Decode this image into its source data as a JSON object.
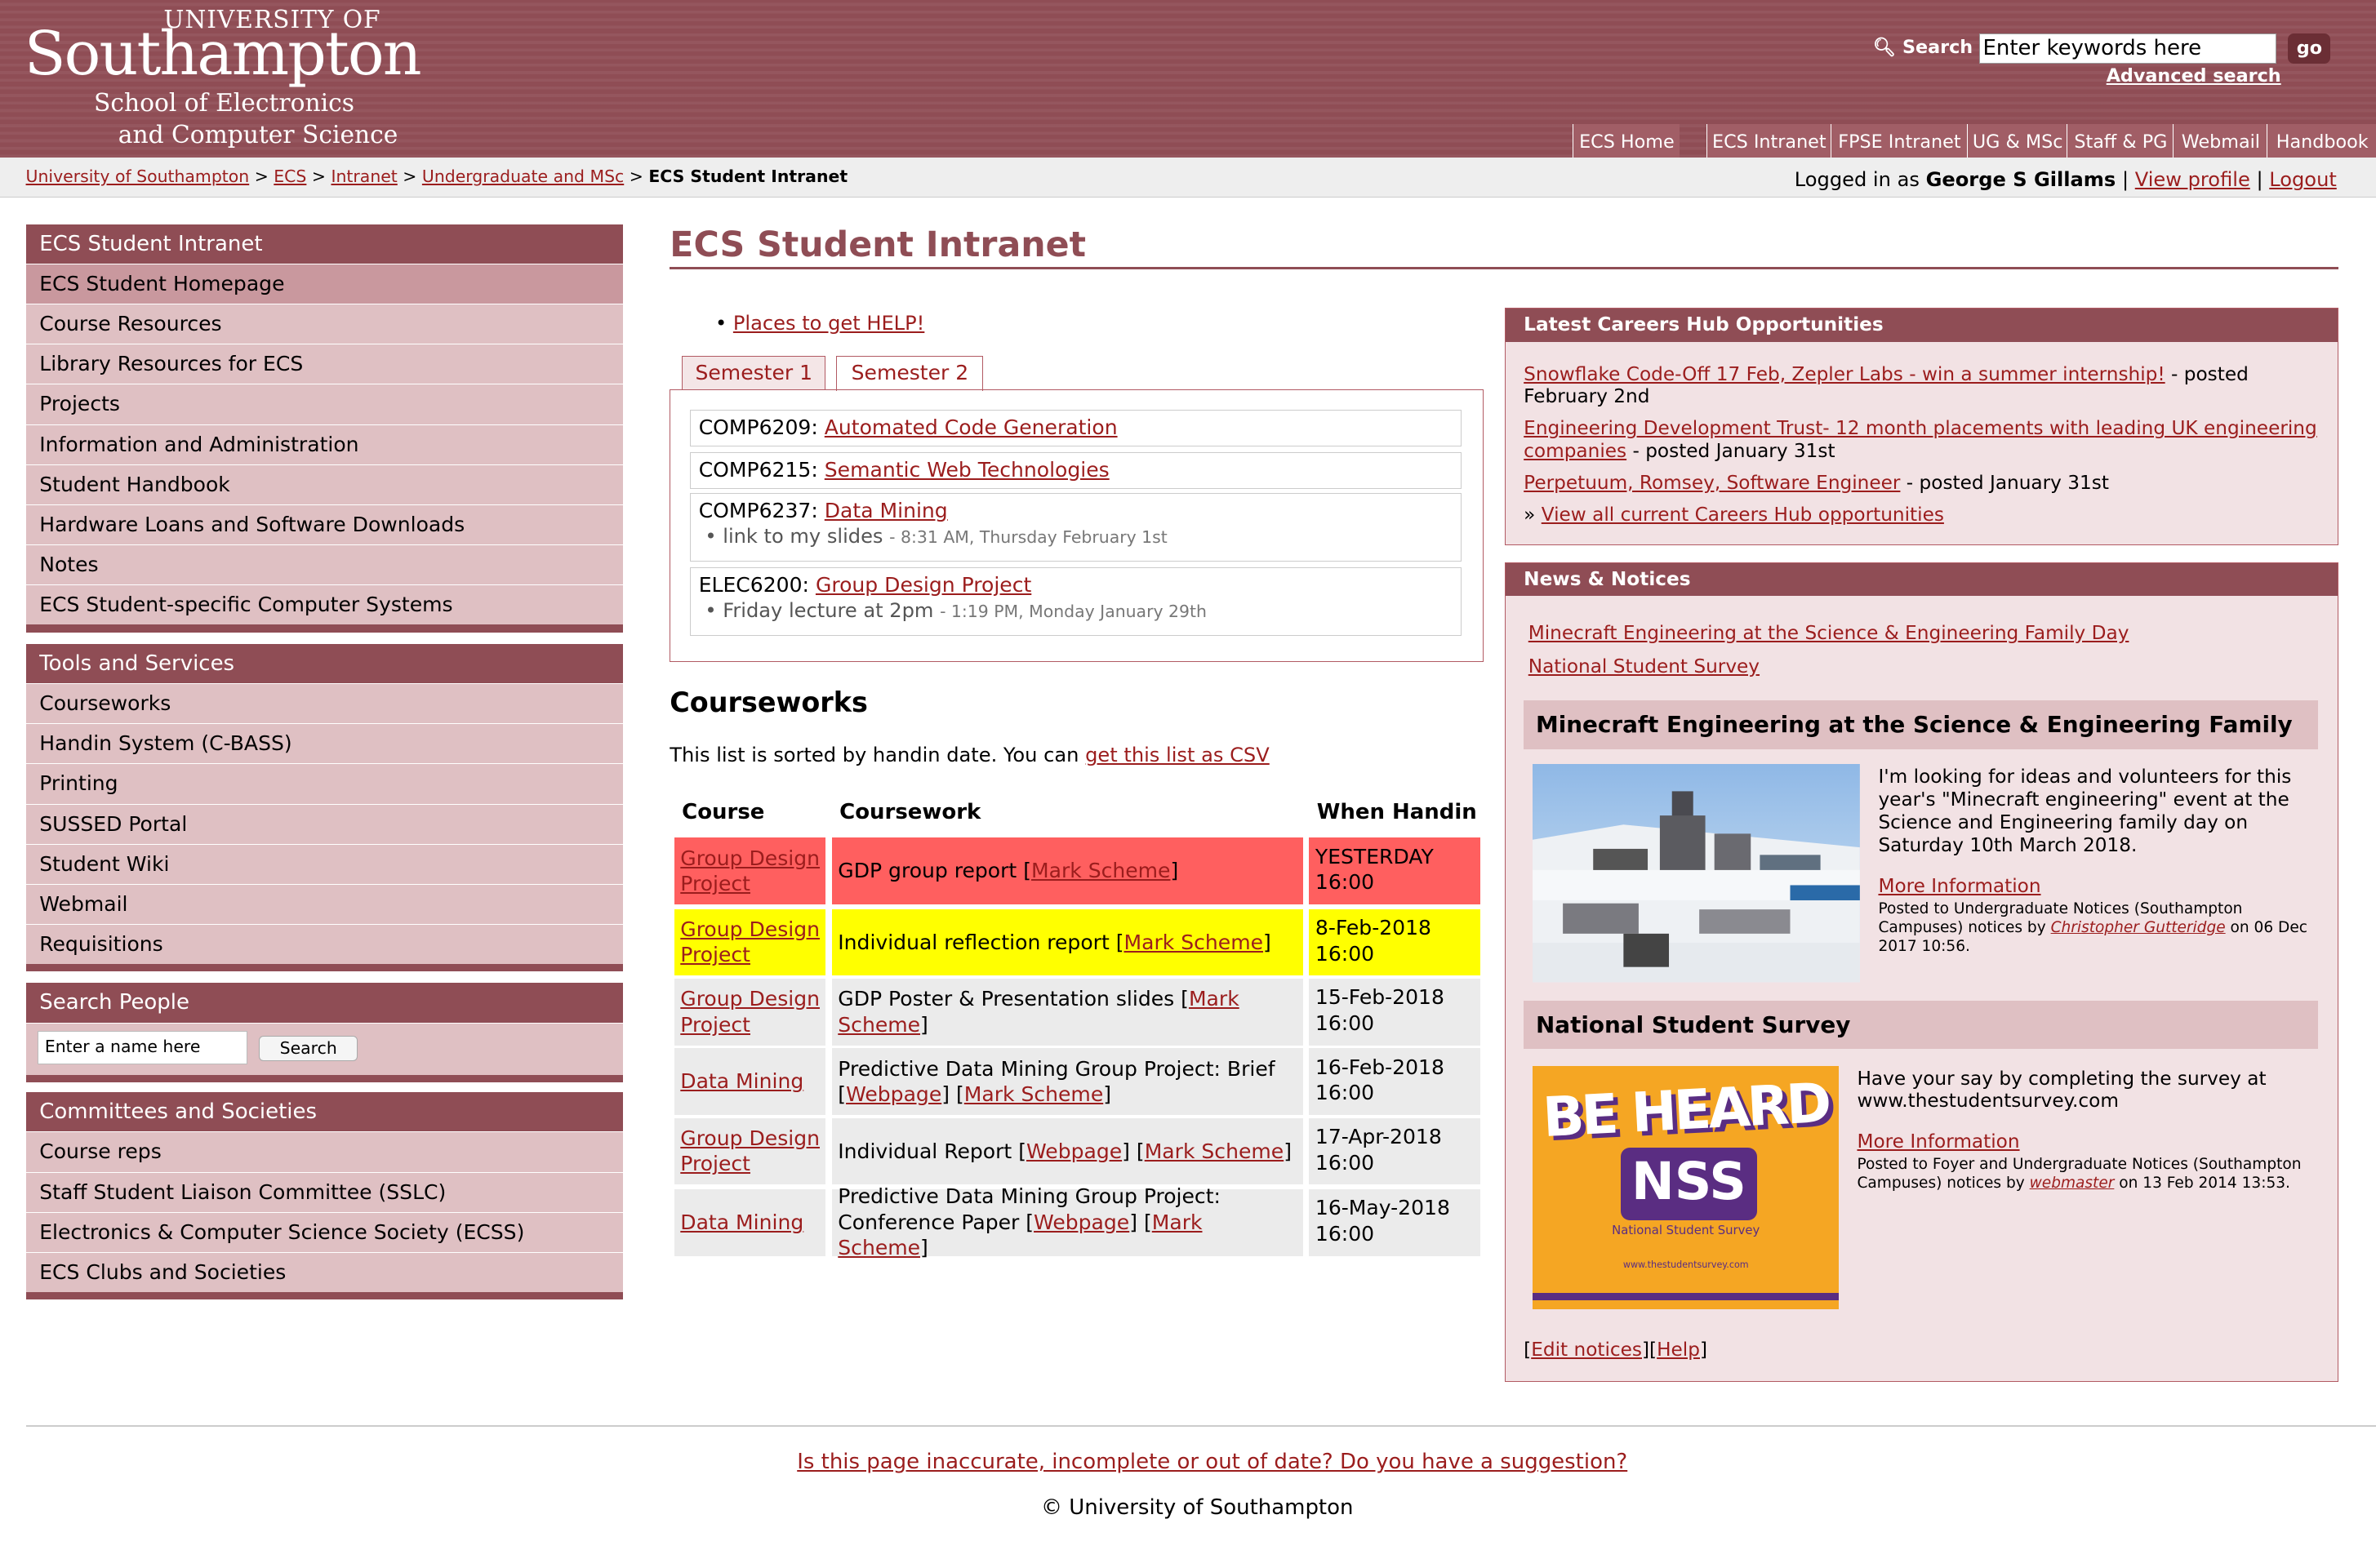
{
  "header": {
    "logo": {
      "line1": "UNIVERSITY OF",
      "line2": "Southampton",
      "line3": "School of Electronics",
      "line4": "and Computer Science"
    },
    "search_label": "Search",
    "search_placeholder": "Enter keywords here",
    "go_label": "go",
    "advanced_search": "Advanced search",
    "tabs": [
      "ECS Home",
      "ECS Intranet",
      "FPSE Intranet",
      "UG & MSc",
      "Staff & PG",
      "Webmail",
      "Handbook"
    ]
  },
  "breadcrumb": {
    "items": [
      "University of Southampton",
      "ECS",
      "Intranet",
      "Undergraduate and MSc"
    ],
    "separator": ">",
    "current": "ECS Student Intranet"
  },
  "login": {
    "prefix": "Logged in as",
    "user": "George S Gillams",
    "view_profile": "View profile",
    "logout": "Logout",
    "sep": "|"
  },
  "sidebar": {
    "intranet": {
      "title": "ECS Student Intranet",
      "items": [
        "ECS Student Homepage",
        "Course Resources",
        "Library Resources for ECS",
        "Projects",
        "Information and Administration",
        "Student Handbook",
        "Hardware Loans and Software Downloads",
        "Notes",
        "ECS Student-specific Computer Systems"
      ]
    },
    "tools": {
      "title": "Tools and Services",
      "items": [
        "Courseworks",
        "Handin System (C-BASS)",
        "Printing",
        "SUSSED Portal",
        "Student Wiki",
        "Webmail",
        "Requisitions"
      ]
    },
    "people": {
      "title": "Search People",
      "placeholder": "Enter a name here",
      "button": "Search"
    },
    "committees": {
      "title": "Committees and Societies",
      "items": [
        "Course reps",
        "Staff Student Liaison Committee (SSLC)",
        "Electronics & Computer Science Society (ECSS)",
        "ECS Clubs and Societies"
      ]
    }
  },
  "main": {
    "title": "ECS Student Intranet",
    "help_link": "Places to get HELP!",
    "semester_tabs": [
      "Semester 1",
      "Semester 2"
    ],
    "modules": [
      {
        "code": "COMP6209:",
        "name": "Automated Code Generation"
      },
      {
        "code": "COMP6215:",
        "name": "Semantic Web Technologies"
      },
      {
        "code": "COMP6237:",
        "name": "Data Mining",
        "note": "link to my slides",
        "ts": "- 8:31 AM, Thursday February 1st"
      },
      {
        "code": "ELEC6200:",
        "name": "Group Design Project",
        "note": "Friday lecture at 2pm",
        "ts": "- 1:19 PM, Monday January 29th"
      }
    ],
    "courseworks": {
      "title": "Courseworks",
      "intro": "This list is sorted by handin date. You can",
      "csv_link": "get this list as CSV",
      "headers": [
        "Course",
        "Coursework",
        "When Handin"
      ],
      "rows": [
        {
          "course": "Group Design Project",
          "work": "GDP group report [",
          "links": [
            "Mark Scheme"
          ],
          "end": "]",
          "date": "YESTERDAY",
          "time": "16:00",
          "status": "overdue"
        },
        {
          "course": "Group Design Project",
          "work": "Individual reflection report [",
          "links": [
            "Mark Scheme"
          ],
          "end": "]",
          "date": "8-Feb-2018",
          "time": "16:00",
          "status": "soon"
        },
        {
          "course": "Group Design Project",
          "work": "GDP Poster & Presentation slides [",
          "links": [
            "Mark Scheme"
          ],
          "end": "]",
          "date": "15-Feb-2018",
          "time": "16:00",
          "status": "later"
        },
        {
          "course": "Data Mining",
          "work": "Predictive Data Mining Group Project: Brief [",
          "links": [
            "Webpage",
            "Mark Scheme"
          ],
          "end": "]",
          "date": "16-Feb-2018",
          "time": "16:00",
          "status": "later"
        },
        {
          "course": "Group Design Project",
          "work": "Individual Report [",
          "links": [
            "Webpage",
            "Mark Scheme"
          ],
          "end": "]",
          "date": "17-Apr-2018",
          "time": "16:00",
          "status": "later"
        },
        {
          "course": "Data Mining",
          "work": "Predictive Data Mining Group Project: Conference Paper [",
          "links": [
            "Webpage",
            "Mark Scheme"
          ],
          "end": "]",
          "date": "16-May-2018",
          "time": "16:00",
          "status": "later"
        }
      ]
    }
  },
  "careers": {
    "title": "Latest Careers Hub Opportunities",
    "items": [
      {
        "link": "Snowflake Code-Off 17 Feb, Zepler Labs - win a summer internship!",
        "posted": " - posted February 2nd"
      },
      {
        "link": "Engineering Development Trust- 12 month placements with leading UK engineering companies",
        "posted": " - posted January 31st"
      },
      {
        "link": "Perpetuum, Romsey, Software Engineer",
        "posted": " - posted January 31st"
      }
    ],
    "view_all": "View all current Careers Hub opportunities",
    "view_all_prefix": "»"
  },
  "news": {
    "title": "News & Notices",
    "top_links": [
      "Minecraft Engineering at the Science & Engineering Family Day",
      "National Student Survey"
    ],
    "notices": [
      {
        "title": "Minecraft Engineering at the Science & Engineering Family Day",
        "body": "I'm looking for ideas and volunteers for this year's \"Minecraft engineering\" event at the Science and Engineering family day on Saturday 10th March 2018.",
        "more": "More Information",
        "posted": "Posted to Undergraduate Notices (Southampton Campuses) notices by",
        "author": "Christopher Gutteridge",
        "date": "on 06 Dec 2017 10:56."
      },
      {
        "title": "National Student Survey",
        "body": "Have your say by completing the survey at www.thestudentsurvey.com",
        "more": "More Information",
        "posted": "Posted to Foyer and Undergraduate Notices (Southampton Campuses) notices by",
        "author": "webmaster",
        "date": "on 13 Feb 2014 13:53."
      }
    ],
    "nss_image": {
      "line1": "BE HEARD",
      "line2": "NSS",
      "line3": "National Student Survey",
      "url": "www.thestudentsurvey.com"
    },
    "edit_notices": "Edit notices",
    "help": "Help"
  },
  "footer": {
    "suggest": "Is this page inaccurate, incomplete or out of date? Do you have a suggestion?",
    "copyright": "© University of Southampton"
  },
  "colors": {
    "brand": "#8f4d55",
    "link": "#9b1d1d",
    "overdue": "#ff5f5f",
    "soon": "#ffff00"
  }
}
